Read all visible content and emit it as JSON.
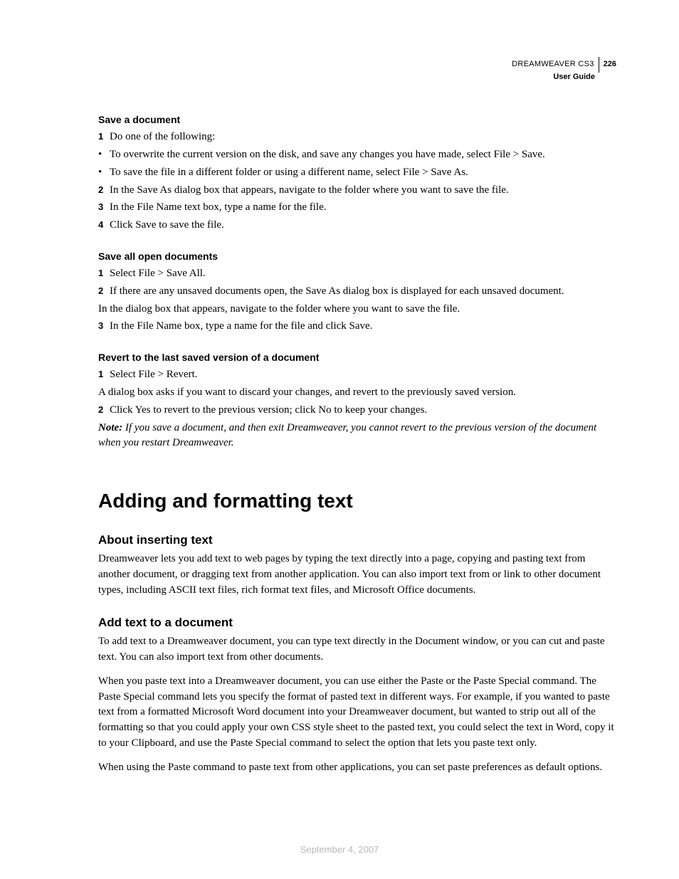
{
  "header": {
    "product": "DREAMWEAVER CS3",
    "page_number": "226",
    "guide": "User Guide"
  },
  "section1": {
    "h": "Save a document",
    "s1": "Do one of the following:",
    "b1": "To overwrite the current version on the disk, and save any changes you have made, select File > Save.",
    "b2": "To save the file in a different folder or using a different name, select File > Save As.",
    "s2": "In the Save As dialog box that appears, navigate to the folder where you want to save the file.",
    "s3": "In the File Name text box, type a name for the file.",
    "s4": "Click Save to save the file."
  },
  "section2": {
    "h": "Save all open documents",
    "s1": "Select File > Save All.",
    "s2": "If there are any unsaved documents open, the Save As dialog box is displayed for each unsaved document.",
    "p1": "In the dialog box that appears, navigate to the folder where you want to save the file.",
    "s3": "In the File Name box, type a name for the file and click Save."
  },
  "section3": {
    "h": "Revert to the last saved version of a document",
    "s1": "Select File > Revert.",
    "p1": "A dialog box asks if you want to discard your changes, and revert to the previously saved version.",
    "s2": "Click Yes to revert to the previous version; click No to keep your changes.",
    "note_label": "Note:",
    "note_body": " If you save a document, and then exit Dreamweaver, you cannot revert to the previous version of the document when you restart Dreamweaver."
  },
  "main_heading": "Adding and formatting text",
  "topic1": {
    "h": "About inserting text",
    "p1": "Dreamweaver lets you add text to web pages by typing the text directly into a page, copying and pasting text from another document, or dragging text from another application. You can also import text from or link to other document types, including ASCII text files, rich format text files, and Microsoft Office documents."
  },
  "topic2": {
    "h": "Add text to a document",
    "p1": "To add text to a Dreamweaver document, you can type text directly in the Document window, or you can cut and paste text. You can also import text from other documents.",
    "p2": "When you paste text into a Dreamweaver document, you can use either the Paste or the Paste Special command. The Paste Special command lets you specify the format of pasted text in different ways. For example, if you wanted to paste text from a formatted Microsoft Word document into your Dreamweaver document, but wanted to strip out all of the formatting so that you could apply your own CSS style sheet to the pasted text, you could select the text in Word, copy it to your Clipboard, and use the Paste Special command to select the option that lets you paste text only.",
    "p3": "When using the Paste command to paste text from other applications, you can set paste preferences as default options."
  },
  "footer_date": "September 4, 2007"
}
